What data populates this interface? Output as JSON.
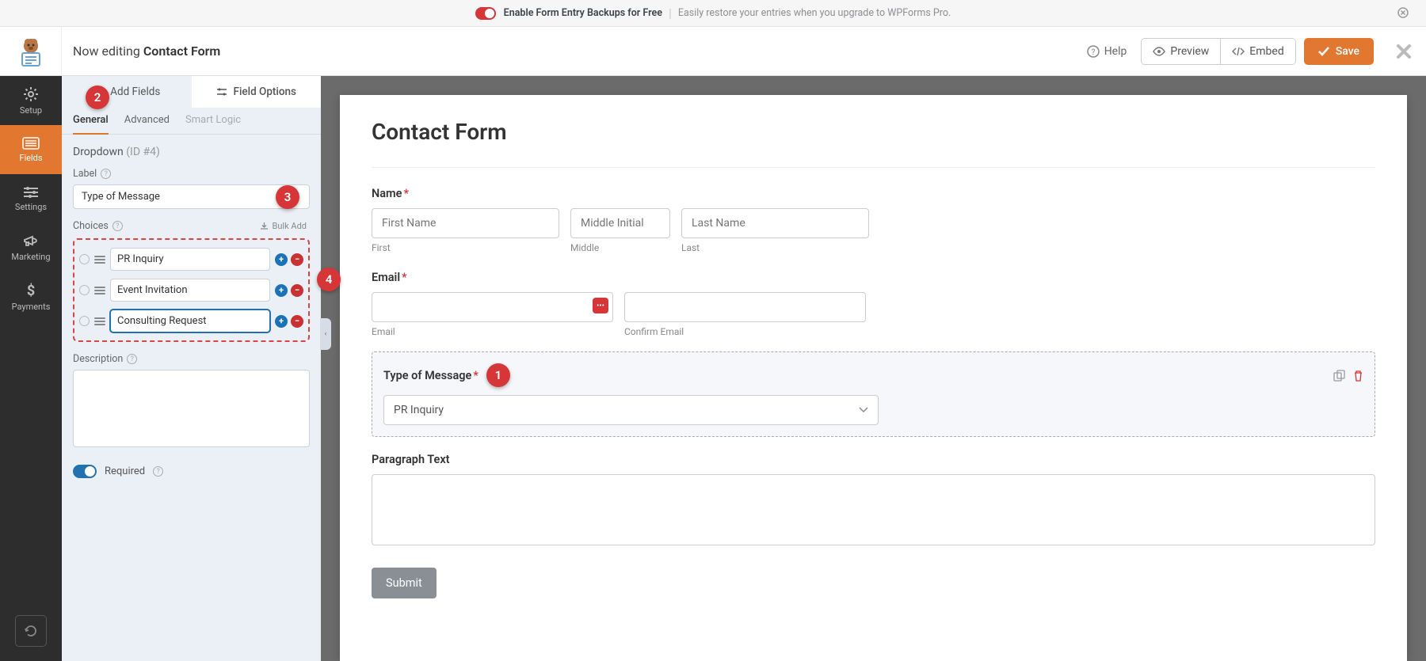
{
  "banner": {
    "bold": "Enable Form Entry Backups for Free",
    "light": "Easily restore your entries when you upgrade to WPForms Pro."
  },
  "header": {
    "prefix": "Now editing",
    "title": "Contact Form",
    "help": "Help",
    "preview": "Preview",
    "embed": "Embed",
    "save": "Save"
  },
  "vnav": {
    "setup": "Setup",
    "fields": "Fields",
    "settings": "Settings",
    "marketing": "Marketing",
    "payments": "Payments"
  },
  "panel": {
    "tab_add": "Add Fields",
    "tab_options": "Field Options",
    "subtab_general": "General",
    "subtab_advanced": "Advanced",
    "subtab_smart": "Smart Logic",
    "field_type": "Dropdown",
    "field_id": "(ID #4)",
    "label_label": "Label",
    "label_value": "Type of Message",
    "choices_label": "Choices",
    "bulk_add": "Bulk Add",
    "choices": [
      "PR Inquiry",
      "Event Invitation",
      "Consulting Request"
    ],
    "description_label": "Description",
    "required_label": "Required"
  },
  "annotations": {
    "a1": "1",
    "a2": "2",
    "a3": "3",
    "a4": "4"
  },
  "preview": {
    "form_title": "Contact Form",
    "name_label": "Name",
    "first_ph": "First Name",
    "middle_ph": "Middle Initial",
    "last_ph": "Last Name",
    "first_sub": "First",
    "middle_sub": "Middle",
    "last_sub": "Last",
    "email_label": "Email",
    "email_sub": "Email",
    "confirm_sub": "Confirm Email",
    "type_label": "Type of Message",
    "type_value": "PR Inquiry",
    "para_label": "Paragraph Text",
    "submit": "Submit"
  }
}
